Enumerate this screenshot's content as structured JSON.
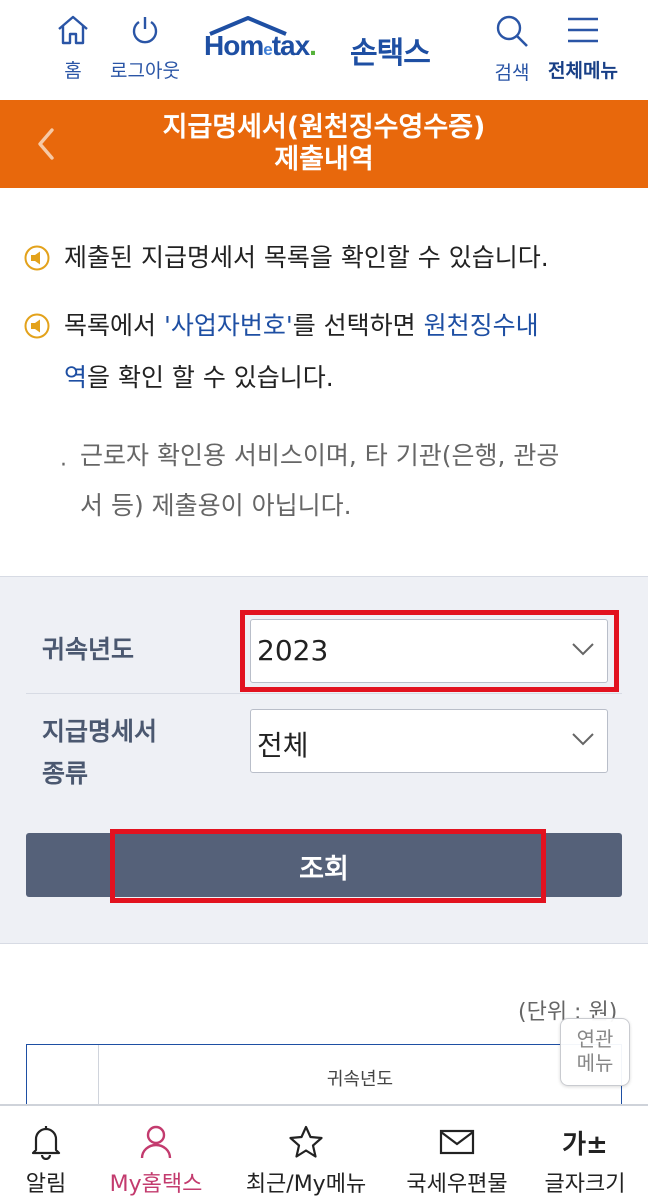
{
  "header": {
    "home_label": "홈",
    "logout_label": "로그아웃",
    "logo_text_left": "Hom",
    "logo_text_e": "e",
    "logo_text_right": "tax",
    "logo_dot": ".",
    "logo_sub": "손택스",
    "search_label": "검색",
    "menu_label": "전체메뉴"
  },
  "title_bar": {
    "line1": "지급명세서(원천징수영수증)",
    "line2": "제출내역"
  },
  "info": {
    "line1": "제출된 지급명세서 목록을 확인할 수 있습니다.",
    "line2_a": "목록에서 ",
    "line2_link": "'사업자번호'",
    "line2_b": "를 선택하면 ",
    "line2_blue": "원천징수내",
    "line3_blue": "역",
    "line3_b": "을 확인 할 수 있습니다.",
    "note_bullet": "·",
    "note_line1": "근로자 확인용 서비스이며, 타 기관(은행, 관공",
    "note_line2": "서 등) 제출용이 아닙니다."
  },
  "search_form": {
    "year_label": "귀속년도",
    "year_value": "2023",
    "type_label_1": "지급명세서",
    "type_label_2": "종류",
    "type_value": "전체",
    "submit_label": "조회"
  },
  "results": {
    "unit_label": "(단위 : 원)",
    "column_header": "귀속년도"
  },
  "related_menu": {
    "line1": "연관",
    "line2": "메뉴"
  },
  "bottom_nav": {
    "alert": "알림",
    "my_hometax": "My홈택스",
    "recent": "최근/My메뉴",
    "mail": "국세우편물",
    "font_size_glyph": "가±",
    "font_size": "글자크기"
  },
  "colors": {
    "brand_blue": "#1e4fa3",
    "title_orange": "#e8680c",
    "highlight_red": "#e2121f",
    "button_slate": "#556179",
    "active_nav": "#c33b6e"
  }
}
